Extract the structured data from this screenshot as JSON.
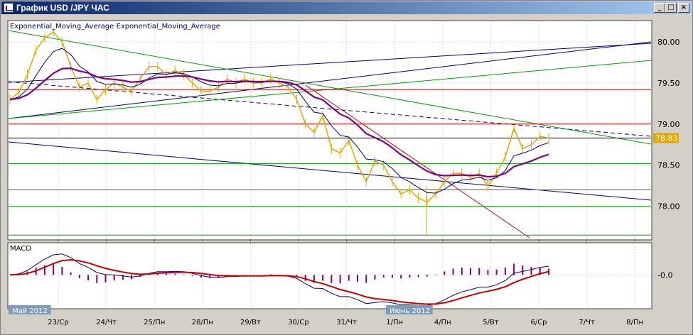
{
  "window": {
    "title": "График USD /JPY  ЧАС",
    "buttons": {
      "minimize": "_",
      "maximize": "□",
      "close": "×"
    }
  },
  "chart_data": {
    "type": "line",
    "title": "",
    "price_panel": {
      "indicator_label": "Exponential_Moving_Average Exponential_Moving_Average",
      "ylim": [
        77.6,
        80.25
      ],
      "yticks": [
        "80.00",
        "79.50",
        "79.00",
        "78.50",
        "78.00"
      ],
      "ytick_values": [
        80.0,
        79.5,
        79.0,
        78.5,
        78.0
      ],
      "last_price": "78.83",
      "last_price_value": 78.83,
      "price_series_color": "#e0a800",
      "ema_fast_color": "#000080",
      "ema_slow_color": "#800080",
      "horizontal_levels": [
        {
          "value": 79.42,
          "color": "#cc0000"
        },
        {
          "value": 79.0,
          "color": "#cc0000"
        },
        {
          "value": 78.83,
          "color": "#000000"
        },
        {
          "value": 78.52,
          "color": "#00a000"
        },
        {
          "value": 78.2,
          "color": "#00a000"
        },
        {
          "value": 78.0,
          "color": "#00a000"
        },
        {
          "value": 77.65,
          "color": "#00a000"
        }
      ],
      "close_series": [
        79.3,
        79.38,
        79.6,
        79.9,
        80.05,
        80.12,
        80.0,
        79.7,
        79.45,
        79.5,
        79.3,
        79.42,
        79.5,
        79.45,
        79.4,
        79.55,
        79.7,
        79.7,
        79.6,
        79.65,
        79.6,
        79.5,
        79.4,
        79.4,
        79.45,
        79.55,
        79.5,
        79.55,
        79.5,
        79.5,
        79.55,
        79.5,
        79.45,
        79.3,
        79.0,
        78.9,
        79.1,
        78.7,
        78.65,
        78.8,
        78.5,
        78.3,
        78.55,
        78.5,
        78.3,
        78.15,
        78.2,
        78.1,
        78.05,
        78.15,
        78.3,
        78.4,
        78.4,
        78.35,
        78.4,
        78.25,
        78.4,
        78.6,
        78.95,
        78.7,
        78.75,
        78.85,
        78.83
      ]
    },
    "macd_panel": {
      "label": "MACD",
      "ytick": "-0.0",
      "ytick_value": 0.0,
      "ylim": [
        -0.4,
        0.38
      ]
    },
    "x_axis": {
      "tick_labels": [
        "23/Ср",
        "24/Чт",
        "25/Пн",
        "28/Пн",
        "29/Вт",
        "30/Ср",
        "31/Чт",
        "1/Пн",
        "4/Пн",
        "5/Вт",
        "6/Ср",
        "7/Чт",
        "8/Пн"
      ],
      "month_labels": [
        "Май 2012",
        "Июнь 2012"
      ]
    }
  }
}
